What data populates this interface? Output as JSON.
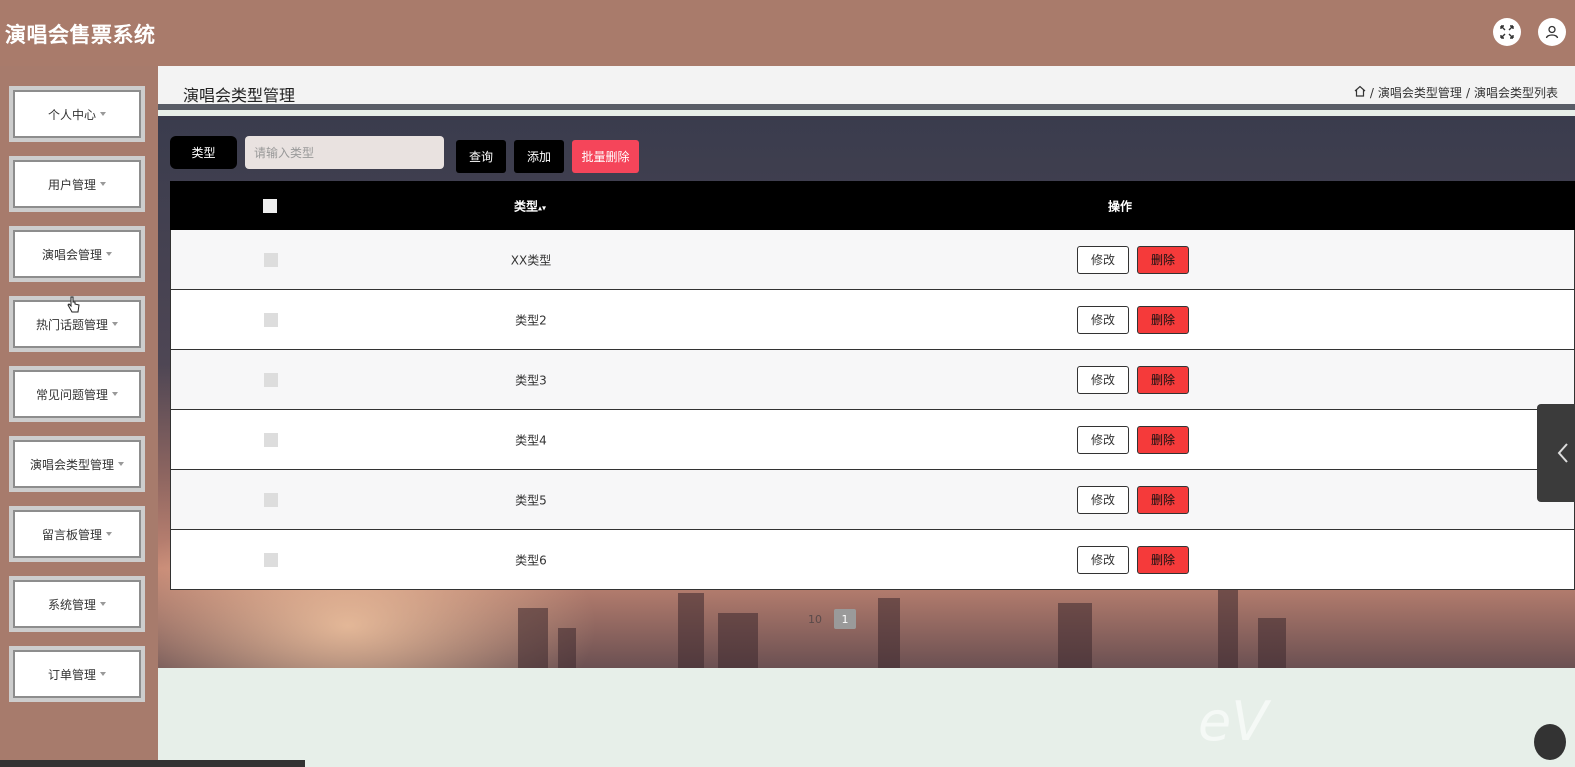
{
  "app": {
    "title": "演唱会售票系统"
  },
  "topbar": {
    "icons": [
      "fullscreen-icon",
      "user-icon"
    ]
  },
  "sidebar": {
    "items": [
      {
        "label": "个人中心"
      },
      {
        "label": "用户管理"
      },
      {
        "label": "演唱会管理"
      },
      {
        "label": "热门话题管理"
      },
      {
        "label": "常见问题管理"
      },
      {
        "label": "演唱会类型管理"
      },
      {
        "label": "留言板管理"
      },
      {
        "label": "系统管理"
      },
      {
        "label": "订单管理"
      }
    ]
  },
  "page": {
    "title": "演唱会类型管理",
    "breadcrumb": [
      "演唱会类型管理",
      "演唱会类型列表"
    ]
  },
  "search": {
    "label": "类型",
    "placeholder": "请输入类型",
    "query_label": "查询",
    "add_label": "添加",
    "batch_delete_label": "批量删除"
  },
  "table": {
    "headers": {
      "type": "类型",
      "sort": "▴▾",
      "actions": "操作"
    },
    "rows": [
      {
        "type": "XX类型"
      },
      {
        "type": "类型2"
      },
      {
        "type": "类型3"
      },
      {
        "type": "类型4"
      },
      {
        "type": "类型5"
      },
      {
        "type": "类型6"
      }
    ],
    "edit_label": "修改",
    "delete_label": "删除"
  },
  "pagination": {
    "page_size": "10",
    "current_page": "1"
  },
  "watermark": "eV",
  "colors": {
    "topbar": "#a97b6b",
    "danger": "#f53a3a",
    "header": "#000000"
  }
}
